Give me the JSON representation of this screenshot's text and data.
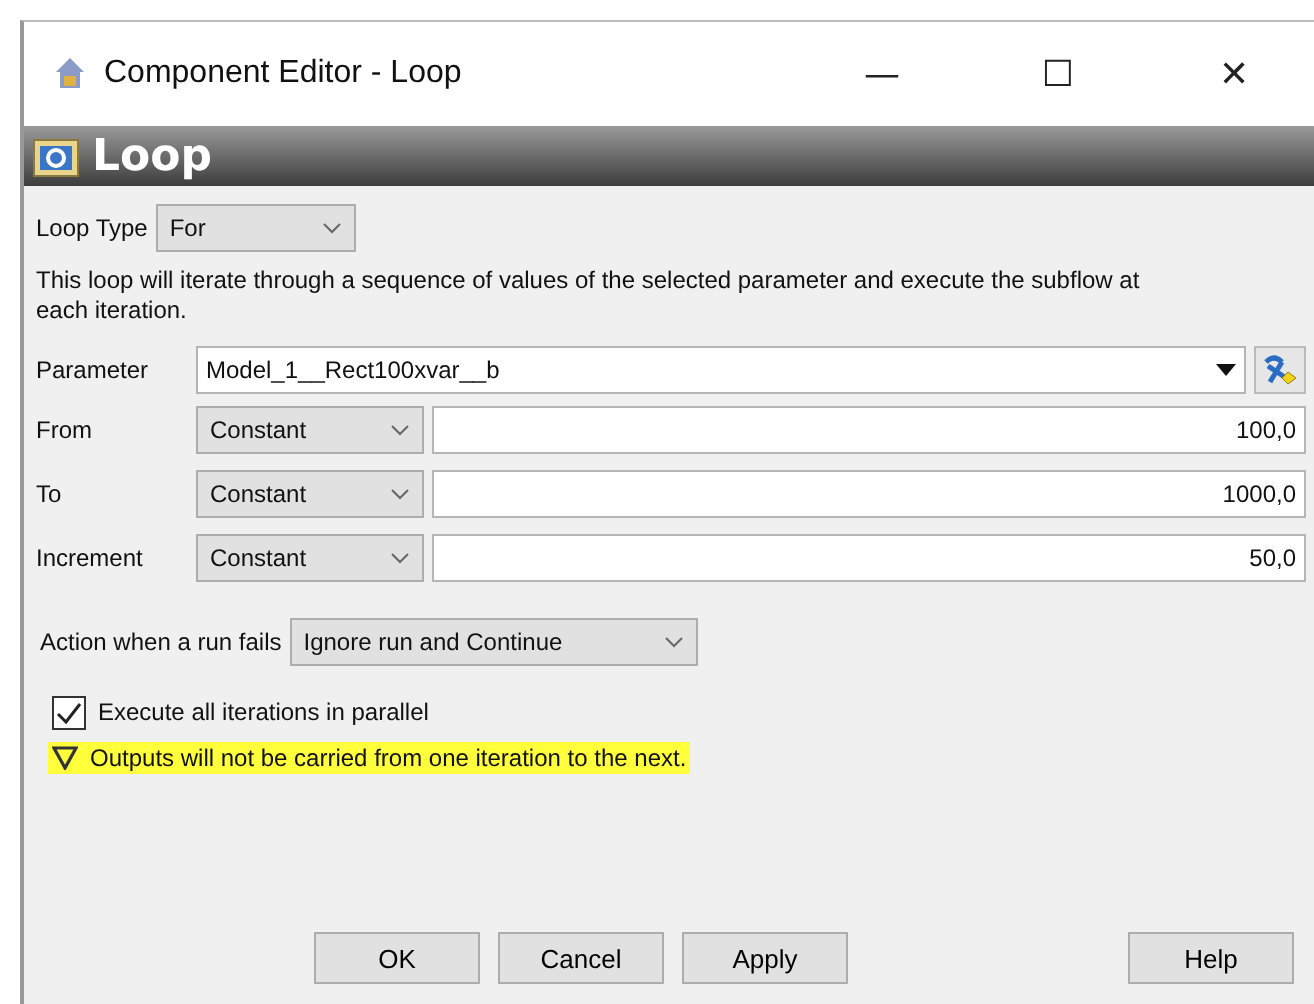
{
  "window": {
    "title": "Component Editor - Loop",
    "controls": [
      "—",
      "☐",
      "✕"
    ]
  },
  "header": {
    "title": "Loop"
  },
  "loop_type": {
    "label": "Loop Type",
    "value": "For"
  },
  "description": "This loop will iterate through a sequence of values of the selected parameter and execute the subflow at each iteration.",
  "parameter": {
    "label": "Parameter",
    "value": "Model_1__Rect100xvar__b"
  },
  "ranges": [
    {
      "label": "From",
      "mode": "Constant",
      "value": "100,0"
    },
    {
      "label": "To",
      "mode": "Constant",
      "value": "1000,0"
    },
    {
      "label": "Increment",
      "mode": "Constant",
      "value": "50,0"
    }
  ],
  "action": {
    "label": "Action when a run fails",
    "value": "Ignore run and Continue"
  },
  "parallel": {
    "label": "Execute all iterations in parallel",
    "checked": true
  },
  "warning": "Outputs will not be carried from one iteration to the next.",
  "buttons": [
    {
      "label": "OK",
      "kind": "main"
    },
    {
      "label": "Cancel",
      "kind": "main"
    },
    {
      "label": "Apply",
      "kind": "main"
    },
    {
      "label": "Help",
      "kind": "aside"
    }
  ]
}
